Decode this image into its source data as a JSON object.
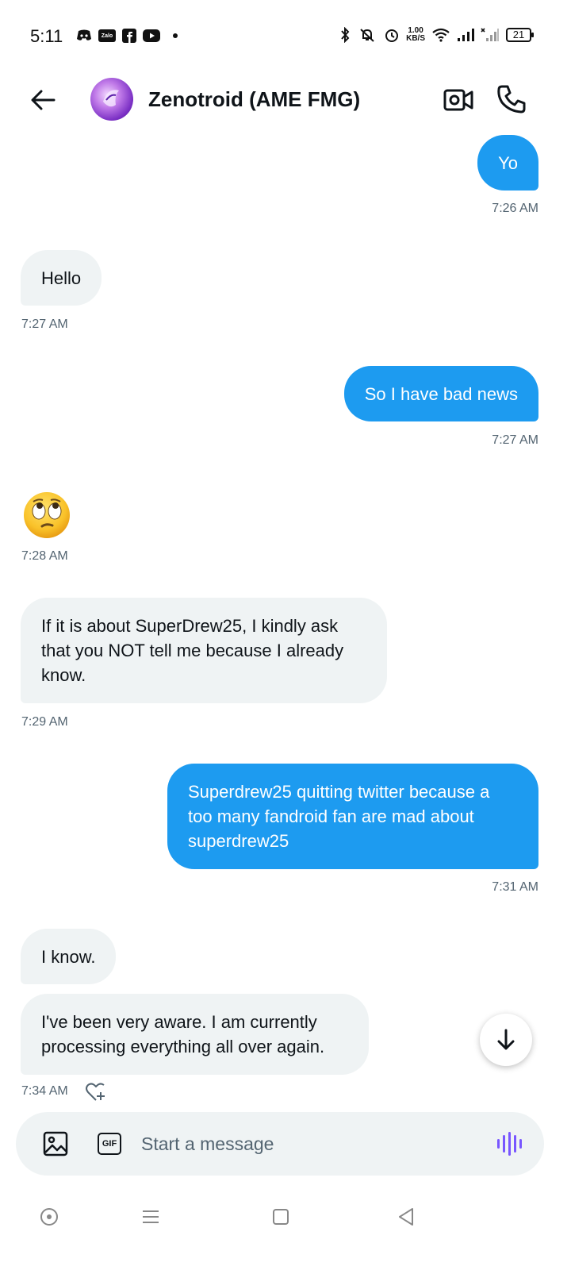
{
  "status_bar": {
    "time": "5:11",
    "net_speed_value": "1.00",
    "net_speed_unit": "KB/S",
    "battery": "21",
    "app_icons": [
      "discord-icon",
      "zalo-icon",
      "facebook-icon",
      "youtube-icon"
    ],
    "zalo_label": "Zalo"
  },
  "header": {
    "title": "Zenotroid (AME FMG)"
  },
  "messages": [
    {
      "side": "sent",
      "text": "Yo",
      "time": "7:26 AM"
    },
    {
      "side": "recv",
      "text": "Hello",
      "time": "7:27 AM"
    },
    {
      "side": "sent",
      "text": "So I have bad news",
      "time": "7:27 AM"
    },
    {
      "side": "recv",
      "emoji": "face-with-rolling-eyes",
      "time": "7:28 AM"
    },
    {
      "side": "recv",
      "text": "If it is about SuperDrew25, I kindly ask that you NOT tell me because I already know.",
      "time": "7:29 AM"
    },
    {
      "side": "sent",
      "text": "Superdrew25 quitting twitter because a too many fandroid fan are mad about superdrew25",
      "time": "7:31 AM"
    },
    {
      "side": "recv",
      "text": "I know."
    },
    {
      "side": "recv",
      "text": "I've been very aware. I am currently processing everything all over again.",
      "time": "7:34 AM"
    }
  ],
  "composer": {
    "placeholder": "Start a message",
    "gif_label": "GIF"
  },
  "colors": {
    "sent_bubble": "#1d9bf0",
    "recv_bubble": "#eff3f4",
    "timestamp": "#536471",
    "voice_accent": "#7856ff"
  }
}
